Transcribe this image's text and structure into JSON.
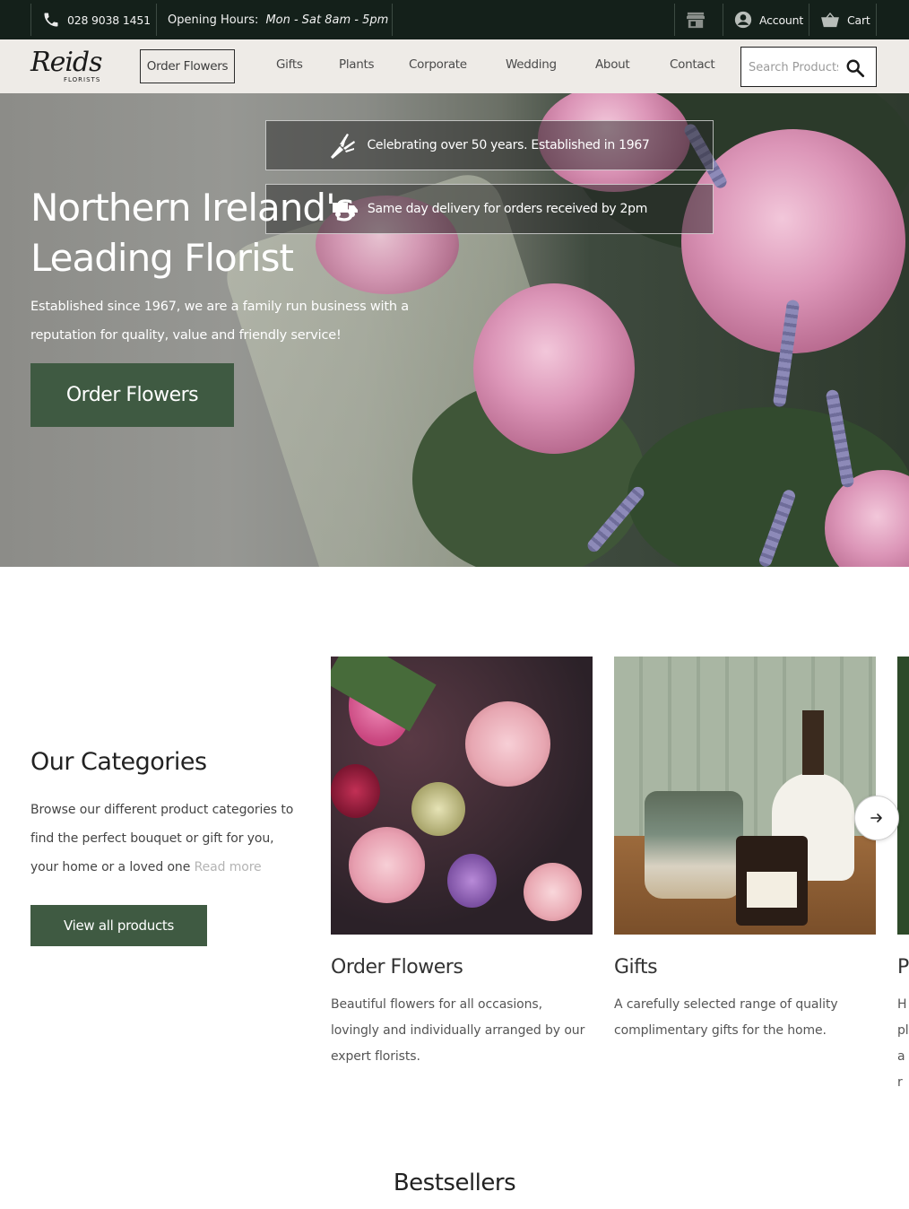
{
  "topbar": {
    "phone": "028 9038 1451",
    "hours_label": "Opening Hours:",
    "hours_value": "Mon - Sat 8am - 5pm",
    "account_label": "Account",
    "cart_label": "Cart"
  },
  "nav": {
    "logo_script": "Reids",
    "logo_sub": "FLORISTS",
    "order_flowers": "Order Flowers",
    "links": [
      "Gifts",
      "Plants",
      "Corporate",
      "Wedding",
      "About",
      "Contact"
    ],
    "search_placeholder": "Search Products"
  },
  "hero": {
    "banner_1": "Celebrating over 50 years. Established in 1967",
    "banner_2": "Same day delivery for orders received by 2pm",
    "heading_line_1": "Northern Ireland's",
    "heading_line_2": "Leading Florist",
    "intro": "Established since 1967, we are a family run business with a reputation for quality, value and friendly service!",
    "cta": "Order Flowers"
  },
  "categories": {
    "title": "Our Categories",
    "description": "Browse our different product categories to find the perfect bouquet or gift for you, your home or a loved one",
    "read_more": "Read more",
    "view_all": "View all products",
    "cards": [
      {
        "title": "Order Flowers",
        "description": "Beautiful flowers for all occasions, lovingly and individually arranged by our expert florists."
      },
      {
        "title": "Gifts",
        "description": "A carefully selected range of quality complimentary gifts for the home."
      },
      {
        "title": "Pl",
        "description": "H pl ar"
      }
    ]
  },
  "bestsellers": {
    "title": "Bestsellers"
  },
  "colors": {
    "topbar_bg": "#14201a",
    "nav_bg": "#eeebe7",
    "brand_green": "#3f5a42"
  }
}
